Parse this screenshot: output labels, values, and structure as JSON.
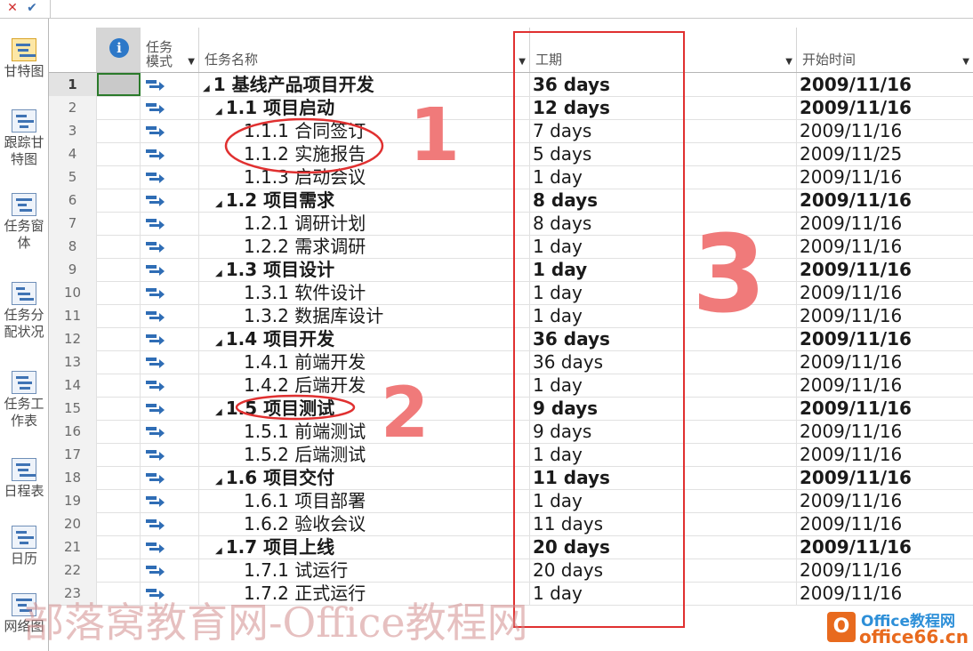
{
  "formula_bar": {
    "cancel_icon": "x-icon",
    "confirm_icon": "check-icon"
  },
  "views": [
    {
      "label": "甘特图",
      "icon": "gantt-chart-icon",
      "active": true
    },
    {
      "label": "跟踪甘特图",
      "icon": "tracking-gantt-icon",
      "active": false
    },
    {
      "label": "任务窗体",
      "icon": "task-form-icon",
      "active": false
    },
    {
      "label": "任务分配状况",
      "icon": "task-usage-icon",
      "active": false
    },
    {
      "label": "任务工作表",
      "icon": "task-sheet-icon",
      "active": false
    },
    {
      "label": "日程表",
      "icon": "timeline-icon",
      "active": false
    },
    {
      "label": "日历",
      "icon": "calendar-icon",
      "active": false
    },
    {
      "label": "网络图",
      "icon": "network-diagram-icon",
      "active": false
    }
  ],
  "columns": {
    "info_icon": "info-icon",
    "mode": "任务模式",
    "name": "任务名称",
    "duration": "工期",
    "start": "开始时间"
  },
  "rows": [
    {
      "id": "1",
      "name": "1 基线产品项目开发",
      "level": 0,
      "summary": true,
      "duration": "36 days",
      "start": "2009/11/16"
    },
    {
      "id": "2",
      "name": "1.1 项目启动",
      "level": 1,
      "summary": true,
      "duration": "12 days",
      "start": "2009/11/16"
    },
    {
      "id": "3",
      "name": "1.1.1 合同签订",
      "level": 2,
      "summary": false,
      "duration": "7 days",
      "start": "2009/11/16"
    },
    {
      "id": "4",
      "name": "1.1.2 实施报告",
      "level": 2,
      "summary": false,
      "duration": "5 days",
      "start": "2009/11/25"
    },
    {
      "id": "5",
      "name": "1.1.3 启动会议",
      "level": 2,
      "summary": false,
      "duration": "1 day",
      "start": "2009/11/16"
    },
    {
      "id": "6",
      "name": "1.2 项目需求",
      "level": 1,
      "summary": true,
      "duration": "8 days",
      "start": "2009/11/16"
    },
    {
      "id": "7",
      "name": "1.2.1 调研计划",
      "level": 2,
      "summary": false,
      "duration": "8 days",
      "start": "2009/11/16"
    },
    {
      "id": "8",
      "name": "1.2.2 需求调研",
      "level": 2,
      "summary": false,
      "duration": "1 day",
      "start": "2009/11/16"
    },
    {
      "id": "9",
      "name": "1.3 项目设计",
      "level": 1,
      "summary": true,
      "duration": "1 day",
      "start": "2009/11/16"
    },
    {
      "id": "10",
      "name": "1.3.1 软件设计",
      "level": 2,
      "summary": false,
      "duration": "1 day",
      "start": "2009/11/16"
    },
    {
      "id": "11",
      "name": "1.3.2 数据库设计",
      "level": 2,
      "summary": false,
      "duration": "1 day",
      "start": "2009/11/16"
    },
    {
      "id": "12",
      "name": "1.4 项目开发",
      "level": 1,
      "summary": true,
      "duration": "36 days",
      "start": "2009/11/16"
    },
    {
      "id": "13",
      "name": "1.4.1 前端开发",
      "level": 2,
      "summary": false,
      "duration": "36 days",
      "start": "2009/11/16"
    },
    {
      "id": "14",
      "name": "1.4.2 后端开发",
      "level": 2,
      "summary": false,
      "duration": "1 day",
      "start": "2009/11/16"
    },
    {
      "id": "15",
      "name": "1.5 项目测试",
      "level": 1,
      "summary": true,
      "duration": "9 days",
      "start": "2009/11/16"
    },
    {
      "id": "16",
      "name": "1.5.1 前端测试",
      "level": 2,
      "summary": false,
      "duration": "9 days",
      "start": "2009/11/16"
    },
    {
      "id": "17",
      "name": "1.5.2 后端测试",
      "level": 2,
      "summary": false,
      "duration": "1 day",
      "start": "2009/11/16"
    },
    {
      "id": "18",
      "name": "1.6 项目交付",
      "level": 1,
      "summary": true,
      "duration": "11 days",
      "start": "2009/11/16"
    },
    {
      "id": "19",
      "name": "1.6.1 项目部署",
      "level": 2,
      "summary": false,
      "duration": "1 day",
      "start": "2009/11/16"
    },
    {
      "id": "20",
      "name": "1.6.2 验收会议",
      "level": 2,
      "summary": false,
      "duration": "11 days",
      "start": "2009/11/16"
    },
    {
      "id": "21",
      "name": "1.7 项目上线",
      "level": 1,
      "summary": true,
      "duration": "20 days",
      "start": "2009/11/16"
    },
    {
      "id": "22",
      "name": "1.7.1 试运行",
      "level": 2,
      "summary": false,
      "duration": "20 days",
      "start": "2009/11/16"
    },
    {
      "id": "23",
      "name": "1.7.2 正式运行",
      "level": 2,
      "summary": false,
      "duration": "1 day",
      "start": "2009/11/16"
    }
  ],
  "annotations": {
    "mark_1": "1",
    "mark_2": "2",
    "mark_3": "3",
    "annotation_color": "#e03030"
  },
  "watermark": "部落窝教育网-Office教程网",
  "logo": {
    "line1": "Office教程网",
    "line2": "office66.cn",
    "badge": "O"
  }
}
